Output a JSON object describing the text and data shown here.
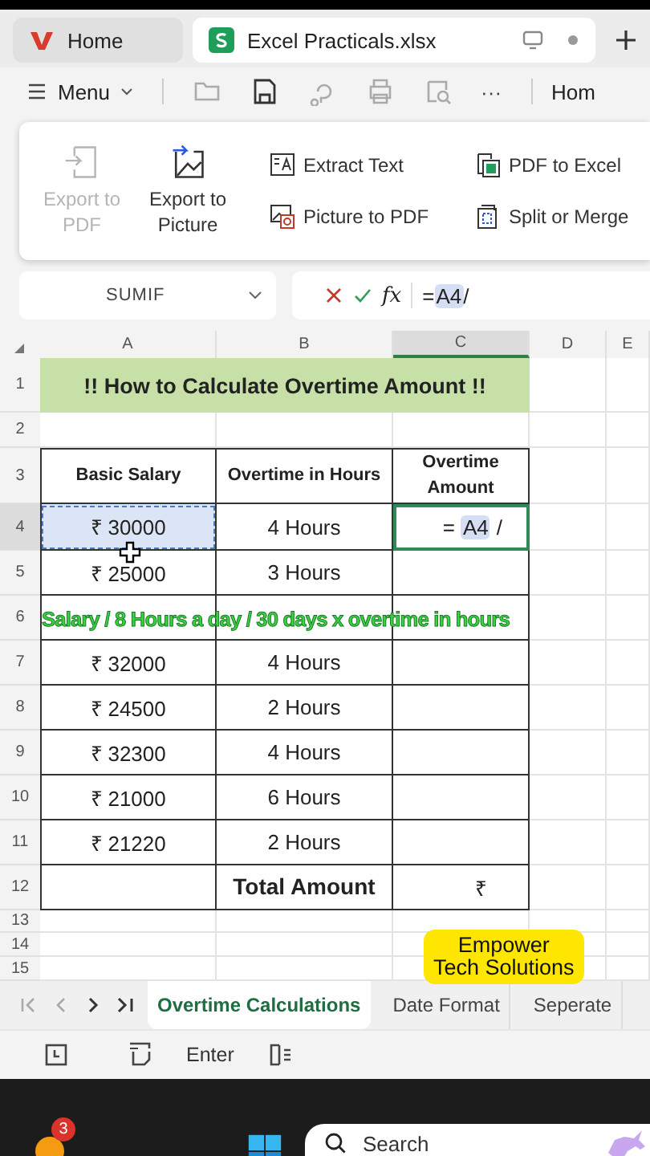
{
  "tabs": [
    {
      "label": "Home",
      "kind": "home",
      "selected": false
    },
    {
      "label": "Excel Practicals.xlsx",
      "kind": "sheet",
      "selected": true
    }
  ],
  "toolbar": {
    "menu": "Menu",
    "more": "···",
    "cut_tab": "Hom"
  },
  "ribbon": {
    "big_buttons": [
      {
        "label": "Export to PDF",
        "kind": "pdf",
        "disabled": true
      },
      {
        "label": "Export to Picture",
        "kind": "picture",
        "disabled": false
      }
    ],
    "small_buttons": [
      {
        "label": "Extract Text",
        "kind": "extract"
      },
      {
        "label": "PDF to Excel",
        "kind": "excel"
      },
      {
        "label": "Picture to PDF",
        "kind": "picpdf"
      },
      {
        "label": "Split or Merge",
        "kind": "split"
      }
    ]
  },
  "formula_bar": {
    "name_box": "SUMIF",
    "fx": "fx",
    "formula_parts": [
      "=",
      "A4",
      "/"
    ]
  },
  "columns": [
    {
      "label": "A",
      "selected": false
    },
    {
      "label": "B",
      "selected": false
    },
    {
      "label": "C",
      "selected": true
    },
    {
      "label": "D",
      "selected": false
    },
    {
      "label": "E",
      "selected": false
    }
  ],
  "row_headers": [
    {
      "label": "1",
      "selected": false
    },
    {
      "label": "2",
      "selected": false
    },
    {
      "label": "3",
      "selected": false
    },
    {
      "label": "4",
      "selected": true
    },
    {
      "label": "5",
      "selected": false
    },
    {
      "label": "6",
      "selected": false
    },
    {
      "label": "7",
      "selected": false
    },
    {
      "label": "8",
      "selected": false
    },
    {
      "label": "9",
      "selected": false
    },
    {
      "label": "10",
      "selected": false
    },
    {
      "label": "11",
      "selected": false
    },
    {
      "label": "12",
      "selected": false
    },
    {
      "label": "13",
      "selected": false
    },
    {
      "label": "14",
      "selected": false
    },
    {
      "label": "15",
      "selected": false
    }
  ],
  "sheet": {
    "title": "!! How to Calculate Overtime Amount !!",
    "headers": [
      "Basic Salary",
      "Overtime in Hours",
      "Overtime Amount"
    ],
    "rows": [
      {
        "kind": "data",
        "salary": "₹ 30000",
        "hours": "4 Hours",
        "highlighted": true,
        "amount_parts": [
          "=",
          "A4",
          "/"
        ]
      },
      {
        "kind": "data",
        "salary": "₹ 25000",
        "hours": "3 Hours",
        "highlighted": false
      },
      {
        "kind": "covered"
      },
      {
        "kind": "data",
        "salary": "₹ 32000",
        "hours": "4 Hours",
        "highlighted": false
      },
      {
        "kind": "data",
        "salary": "₹ 24500",
        "hours": "2 Hours",
        "highlighted": false
      },
      {
        "kind": "data",
        "salary": "₹ 32300",
        "hours": "4 Hours",
        "highlighted": false
      },
      {
        "kind": "data",
        "salary": "₹ 21000",
        "hours": "6 Hours",
        "highlighted": false
      },
      {
        "kind": "data",
        "salary": "₹ 21220",
        "hours": "2 Hours",
        "highlighted": false
      }
    ],
    "total_label": "Total Amount",
    "total_value": "₹"
  },
  "caption": "Salary / 8 Hours a day / 30 days x overtime in hours",
  "brand_badge": [
    "Empower",
    "Tech Solutions"
  ],
  "sheet_tabs": [
    {
      "label": "Overtime Calculations",
      "selected": true
    },
    {
      "label": "Date Format",
      "selected": false
    },
    {
      "label": "Seperate",
      "selected": false
    }
  ],
  "bottom_toolbar": {
    "enter": "Enter"
  },
  "taskbar": {
    "badge": "3",
    "search_placeholder": "Search"
  }
}
